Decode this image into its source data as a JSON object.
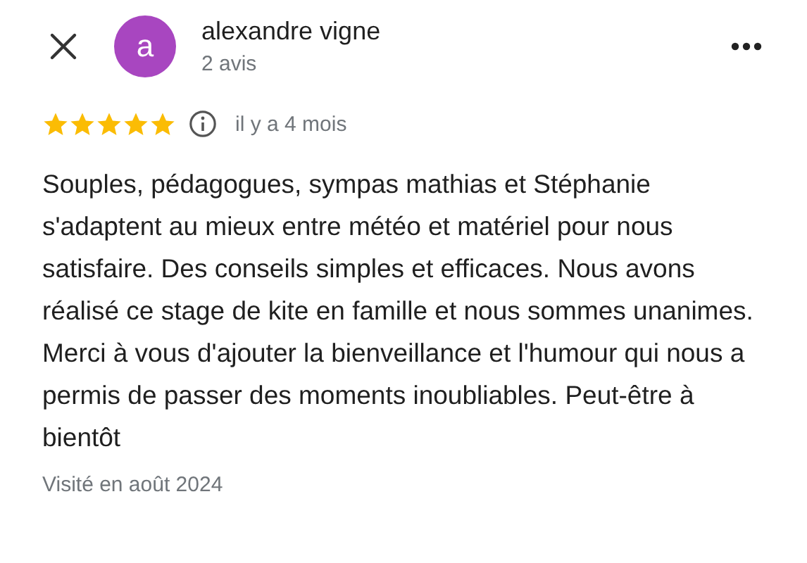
{
  "reviewer": {
    "initial": "a",
    "name": "alexandre vigne",
    "review_count": "2 avis"
  },
  "rating": {
    "stars": 5,
    "time": "il y a 4 mois"
  },
  "review_text": "Souples, pédagogues, sympas mathias et Stéphanie s'adaptent au mieux entre météo et matériel pour nous satisfaire. Des conseils simples et efficaces. Nous avons réalisé ce stage de kite en famille et nous sommes unanimes. Merci à vous d'ajouter la bienveillance et l'humour qui nous a permis de passer des moments inoubliables. Peut-être à bientôt",
  "visit": "Visité en août 2024"
}
